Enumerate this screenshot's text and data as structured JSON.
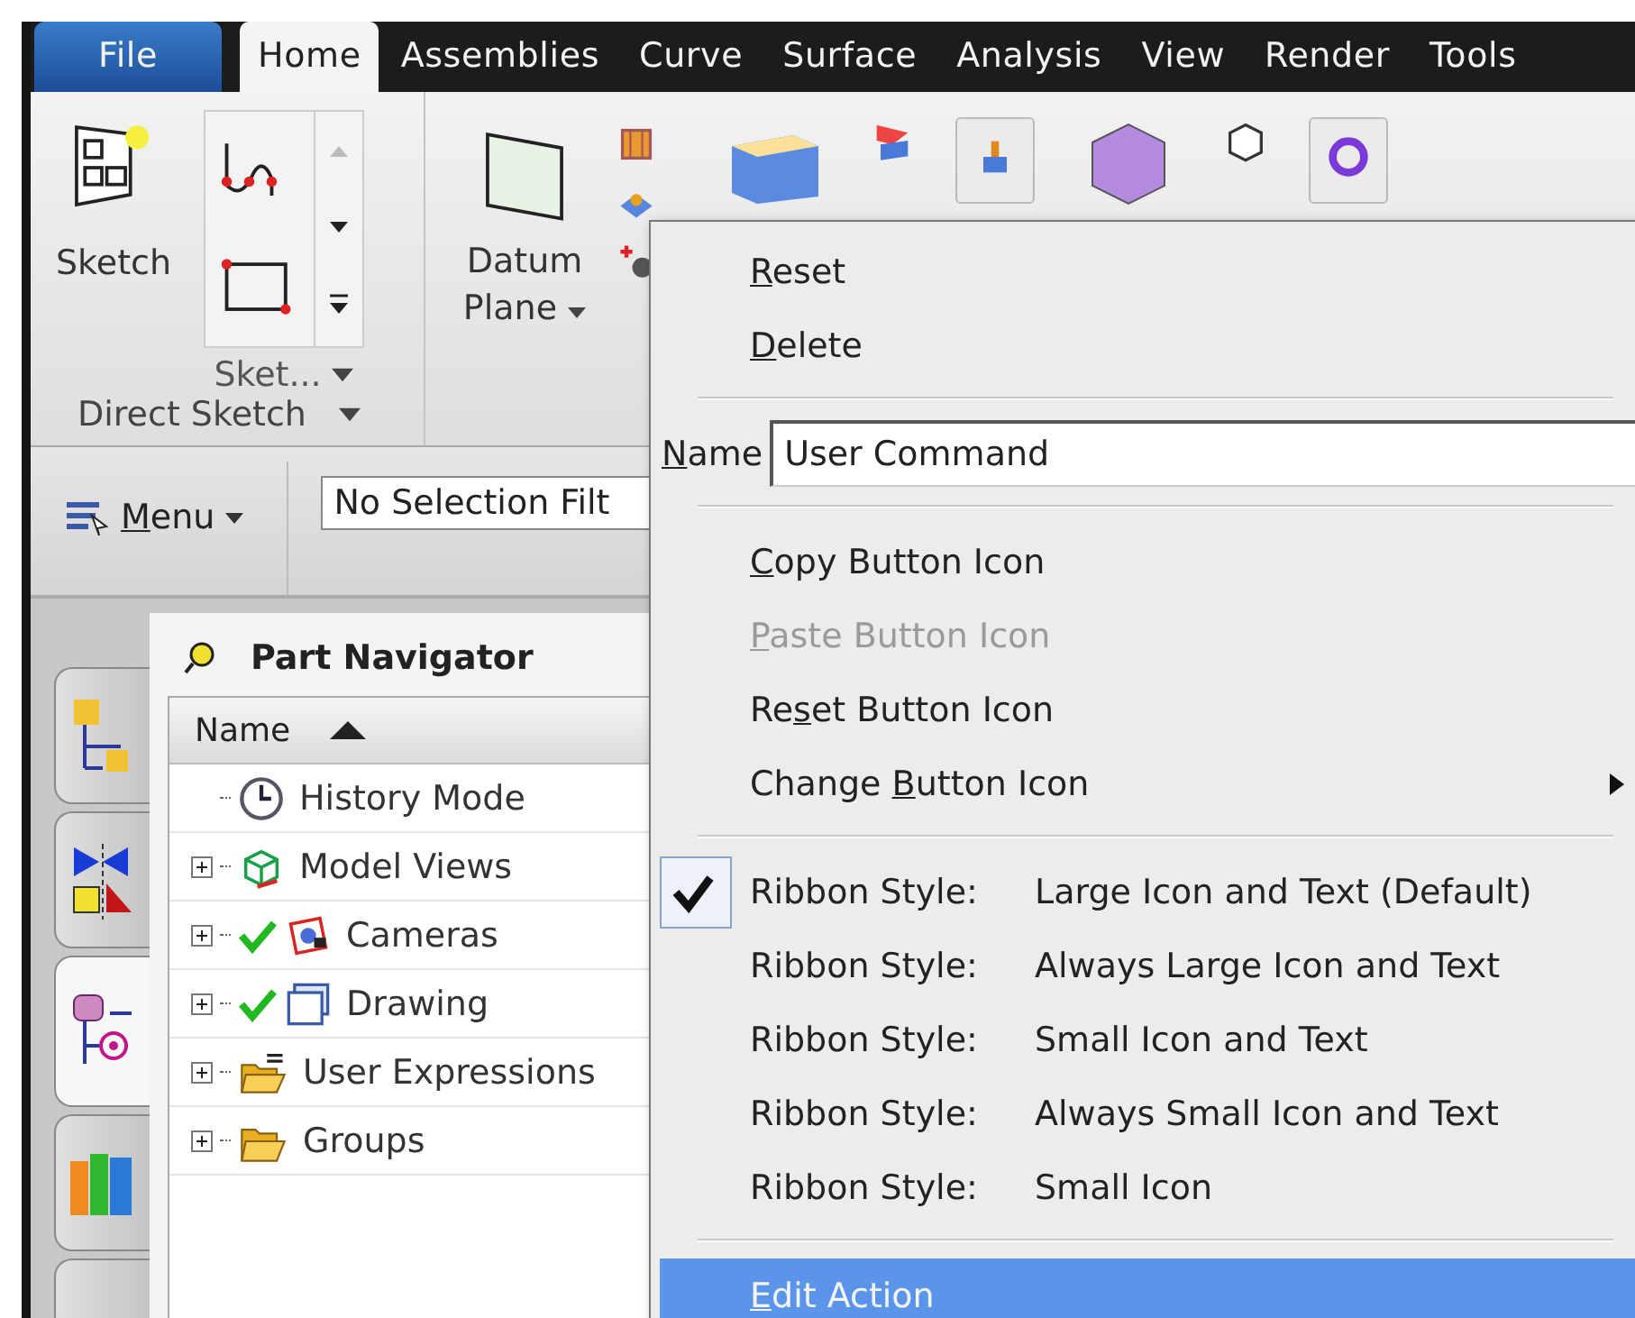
{
  "tabs": [
    {
      "label": "File",
      "kind": "file",
      "selected": false
    },
    {
      "label": "Home",
      "kind": "tab",
      "selected": true
    },
    {
      "label": "Assemblies",
      "kind": "tab",
      "selected": false
    },
    {
      "label": "Curve",
      "kind": "tab",
      "selected": false
    },
    {
      "label": "Surface",
      "kind": "tab",
      "selected": false
    },
    {
      "label": "Analysis",
      "kind": "tab",
      "selected": false
    },
    {
      "label": "View",
      "kind": "tab",
      "selected": false
    },
    {
      "label": "Render",
      "kind": "tab",
      "selected": false
    },
    {
      "label": "Tools",
      "kind": "tab",
      "selected": false
    }
  ],
  "ribbon": {
    "sketch": "Sketch",
    "gallery_label": "Sket...",
    "group_label": "Direct Sketch",
    "datum_plane": "Datum Plane"
  },
  "toolbar": {
    "menu": {
      "key": "M",
      "post": "enu"
    },
    "filter": "No Selection Filt"
  },
  "resource_tabs": [
    {
      "kind": "assembly",
      "selected": false
    },
    {
      "kind": "constraints",
      "selected": false
    },
    {
      "kind": "part",
      "selected": true
    },
    {
      "kind": "library",
      "selected": false
    },
    {
      "kind": "blank",
      "selected": false
    }
  ],
  "navigator": {
    "title": "Part Navigator",
    "column": "Name",
    "items": [
      {
        "label": "History Mode",
        "kind": "history",
        "expandable": false,
        "checked": false
      },
      {
        "label": "Model Views",
        "kind": "views",
        "expandable": true,
        "checked": false
      },
      {
        "label": "Cameras",
        "kind": "cameras",
        "expandable": true,
        "checked": true
      },
      {
        "label": "Drawing",
        "kind": "drawing",
        "expandable": true,
        "checked": true
      },
      {
        "label": "User Expressions",
        "kind": "expressions",
        "expandable": true,
        "checked": false
      },
      {
        "label": "Groups",
        "kind": "folder",
        "expandable": true,
        "checked": false
      }
    ]
  },
  "context_menu": {
    "items": [
      {
        "kind": "command",
        "label": {
          "key": "R",
          "post": "eset"
        },
        "disabled": false,
        "submenu": false,
        "highlighted": false
      },
      {
        "kind": "command",
        "label": {
          "key": "D",
          "post": "elete"
        },
        "disabled": false,
        "submenu": false,
        "highlighted": false
      },
      {
        "kind": "separator"
      },
      {
        "kind": "name_field",
        "label": {
          "key": "N",
          "post": "ame"
        },
        "value": "User Command"
      },
      {
        "kind": "separator"
      },
      {
        "kind": "command",
        "label": {
          "key": "C",
          "post": "opy Button Icon"
        },
        "disabled": false,
        "submenu": false,
        "highlighted": false
      },
      {
        "kind": "command",
        "label": {
          "key": "P",
          "post": "aste Button Icon"
        },
        "disabled": true,
        "submenu": false,
        "highlighted": false
      },
      {
        "kind": "command",
        "label": {
          "pre": "Re",
          "key": "s",
          "post": "et Button Icon"
        },
        "disabled": false,
        "submenu": false,
        "highlighted": false
      },
      {
        "kind": "command",
        "label": {
          "pre": "Change ",
          "key": "B",
          "post": "utton Icon"
        },
        "disabled": false,
        "submenu": true,
        "highlighted": false
      },
      {
        "kind": "separator"
      },
      {
        "kind": "style",
        "label": "Ribbon Style:",
        "value": "Large Icon and Text (Default)",
        "checked": true
      },
      {
        "kind": "style",
        "label": "Ribbon Style:",
        "value": "Always Large Icon and Text",
        "checked": false
      },
      {
        "kind": "style",
        "label": "Ribbon Style:",
        "value": "Small Icon and Text",
        "checked": false
      },
      {
        "kind": "style",
        "label": "Ribbon Style:",
        "value": "Always Small Icon and Text",
        "checked": false
      },
      {
        "kind": "style",
        "label": "Ribbon Style:",
        "value": "Small Icon",
        "checked": false
      },
      {
        "kind": "separator"
      },
      {
        "kind": "command",
        "label": {
          "key": "E",
          "post": "dit Action"
        },
        "disabled": false,
        "submenu": false,
        "highlighted": true
      }
    ]
  }
}
